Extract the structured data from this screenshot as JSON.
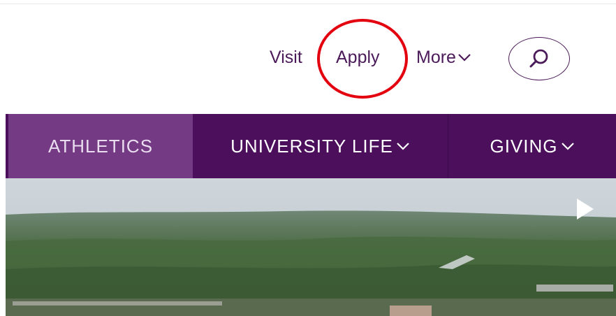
{
  "utility_nav": {
    "visit": "Visit",
    "apply": "Apply",
    "more": "More"
  },
  "main_nav": {
    "athletics": "ATHLETICS",
    "university_life": "UNIVERSITY LIFE",
    "giving": "GIVING"
  },
  "icons": {
    "search": "search-icon",
    "more_chevron": "chevron-down-icon",
    "play": "play-icon"
  },
  "colors": {
    "brand_purple": "#4b0f5c",
    "active_purple": "#753a84",
    "annotation_red": "#e3000f"
  }
}
